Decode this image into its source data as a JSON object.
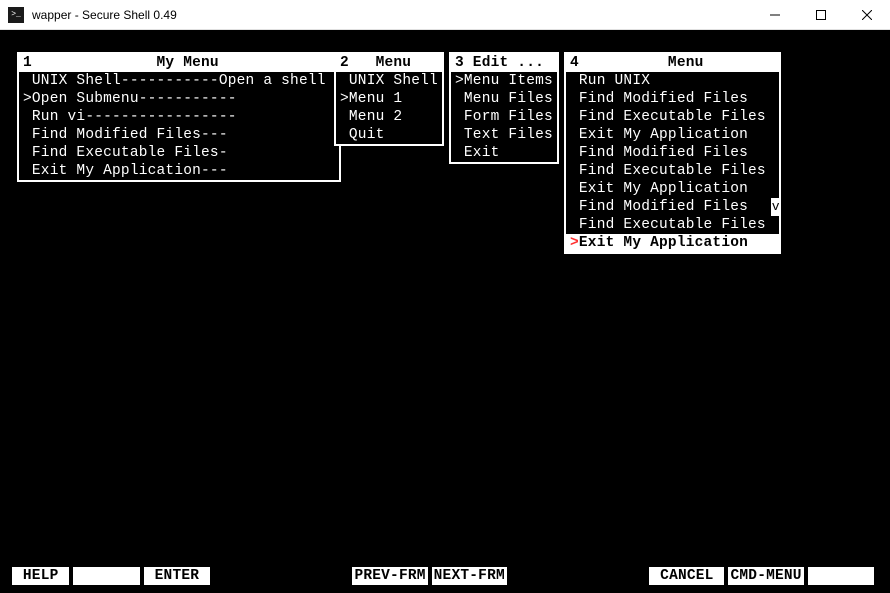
{
  "titlebar": {
    "text": "wapper - Secure Shell 0.49"
  },
  "menus": {
    "m1": {
      "header": "1              My Menu             ",
      "items": [
        {
          "prefix": " ",
          "text": "UNIX Shell-----------Open a shell",
          "suffix": ""
        },
        {
          "prefix": ">",
          "text": "Open Submenu-----------",
          "suffix": ""
        },
        {
          "prefix": " ",
          "text": "Run vi-----------------",
          "suffix": ""
        },
        {
          "prefix": " ",
          "text": "Find Modified Files---",
          "suffix": ""
        },
        {
          "prefix": " ",
          "text": "Find Executable Files-",
          "suffix": ""
        },
        {
          "prefix": " ",
          "text": "Exit My Application---",
          "suffix": ""
        }
      ]
    },
    "m2": {
      "header": "2   Menu   ",
      "items": [
        {
          "prefix": " ",
          "text": "UNIX Shell",
          "suffix": ""
        },
        {
          "prefix": ">",
          "text": "Menu 1",
          "suffix": ""
        },
        {
          "prefix": " ",
          "text": "Menu 2",
          "suffix": ""
        },
        {
          "prefix": " ",
          "text": "Quit",
          "suffix": ""
        }
      ]
    },
    "m3": {
      "header": "3 Edit ... ",
      "items": [
        {
          "prefix": ">",
          "text": "Menu Items",
          "suffix": ""
        },
        {
          "prefix": " ",
          "text": "Menu Files",
          "suffix": ""
        },
        {
          "prefix": " ",
          "text": "Form Files",
          "suffix": ""
        },
        {
          "prefix": " ",
          "text": "Text Files",
          "suffix": ""
        },
        {
          "prefix": " ",
          "text": "Exit",
          "suffix": ""
        }
      ]
    },
    "m4": {
      "header": "4          Menu        ",
      "scroll_char": "v",
      "items": [
        {
          "prefix": " ",
          "text": "Run UNIX",
          "selected": false
        },
        {
          "prefix": " ",
          "text": "Find Modified Files",
          "selected": false
        },
        {
          "prefix": " ",
          "text": "Find Executable Files",
          "selected": false
        },
        {
          "prefix": " ",
          "text": "Exit My Application",
          "selected": false
        },
        {
          "prefix": " ",
          "text": "Find Modified Files",
          "selected": false
        },
        {
          "prefix": " ",
          "text": "Find Executable Files",
          "selected": false
        },
        {
          "prefix": " ",
          "text": "Exit My Application",
          "selected": false
        },
        {
          "prefix": " ",
          "text": "Find Modified Files",
          "selected": false
        },
        {
          "prefix": " ",
          "text": "Find Executable Files",
          "selected": false
        },
        {
          "prefix": ">",
          "text": "Exit My Application",
          "selected": true
        }
      ]
    }
  },
  "bottom_bar": {
    "help": " HELP ",
    "blank1": "       ",
    "enter": " ENTER ",
    "prev": "PREV-FRM",
    "next": "NEXT-FRM",
    "cancel": " CANCEL ",
    "cmdmenu": "CMD-MENU",
    "blank2": "       "
  }
}
